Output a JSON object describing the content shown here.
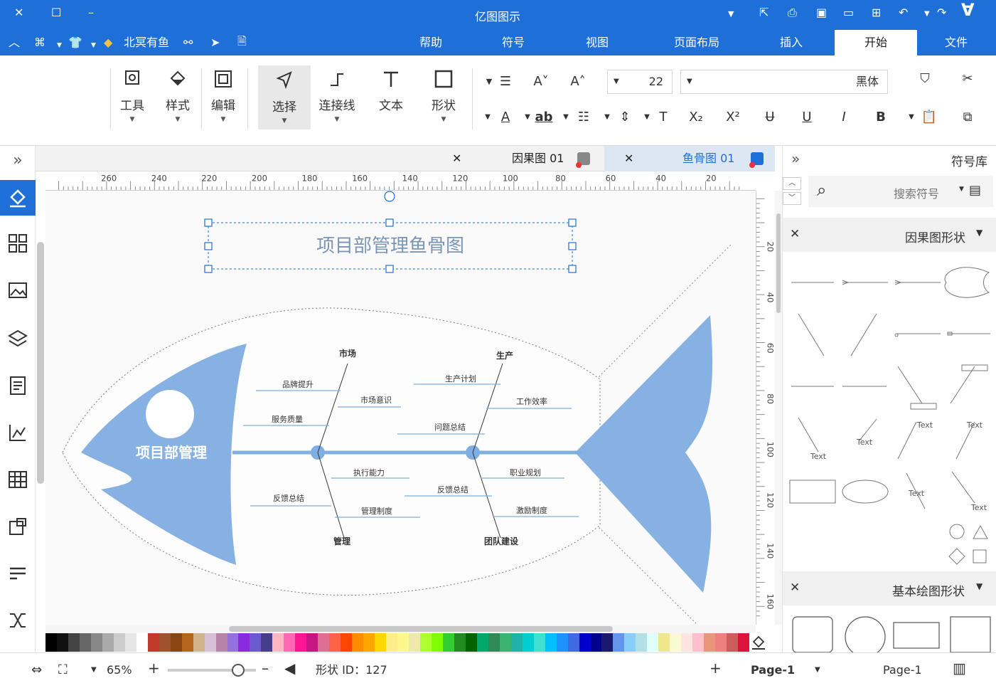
{
  "app": {
    "title": "亿图图示"
  },
  "window": {
    "minimize_icon": "minimize-icon",
    "restore_icon": "restore-icon",
    "close_icon": "close-icon"
  },
  "menu_tabs": [
    "文件",
    "开始",
    "插入",
    "页面布局",
    "视图",
    "符号",
    "帮助"
  ],
  "menu_active": "开始",
  "quickbar": {
    "vip_label": "北冥有鱼"
  },
  "ribbon": {
    "tools": [
      {
        "label": "形状",
        "icon": "rectangle-icon"
      },
      {
        "label": "文本",
        "icon": "text-T-icon"
      },
      {
        "label": "连接线",
        "icon": "connector-icon"
      },
      {
        "label": "选择",
        "icon": "pointer-icon"
      },
      {
        "label": "编辑",
        "icon": "edit-icon"
      },
      {
        "label": "样式",
        "icon": "paint-bucket-icon"
      },
      {
        "label": "工具",
        "icon": "tools-icon"
      }
    ],
    "font_name": "黑体",
    "font_size": "22"
  },
  "doc_tabs": [
    {
      "label": "鱼骨图 01",
      "active": true
    },
    {
      "label": "因果图 01",
      "active": false
    }
  ],
  "ruler": {
    "h_ticks": [
      "20",
      "40",
      "60",
      "80",
      "100",
      "120",
      "140",
      "160",
      "180",
      "200",
      "220",
      "240",
      "260"
    ],
    "v_ticks": [
      "20",
      "40",
      "60",
      "80",
      "100",
      "120",
      "140",
      "160"
    ]
  },
  "diagram": {
    "title": "项目部管理鱼骨图",
    "head_label": "项目部管理",
    "top_categories": [
      {
        "label": "市场",
        "items": [
          "品牌提升",
          "市场意识",
          "服务质量"
        ]
      },
      {
        "label": "生产",
        "items": [
          "生产计划",
          "工作效率",
          "问题总结"
        ]
      }
    ],
    "bottom_categories": [
      {
        "label": "管理",
        "items": [
          "执行能力",
          "反馈总结",
          "管理制度"
        ]
      },
      {
        "label": "团队建设",
        "items": [
          "职业规划",
          "反馈总结",
          "激励制度"
        ]
      }
    ]
  },
  "right_panel": {
    "title": "符号库",
    "search_placeholder": "搜索符号",
    "sections": [
      {
        "label": "因果图形状",
        "shape_text": "Text"
      },
      {
        "label": "基本绘图形状"
      }
    ]
  },
  "status": {
    "page_left": "Page-1",
    "page_current": "Page-1",
    "shape_id": "形状 ID：127",
    "zoom": "65%"
  },
  "colors": {
    "titlebar": "#1f6fd8",
    "fish": "#86b1e2",
    "spine": "#7faee0",
    "accent": "#1f6fd8"
  },
  "palette": [
    "#000000",
    "#111111",
    "#444444",
    "#666666",
    "#888888",
    "#aaaaaa",
    "#cccccc",
    "#e6e6e6",
    "#ffffff",
    "#c0392b",
    "#a0522d",
    "#8b4513",
    "#b5651d",
    "#d2b48c",
    "#d8bfd8",
    "#b784a7",
    "#9370db",
    "#8a2be2",
    "#6a5acd",
    "#483d8b",
    "#ffb6c1",
    "#ff69b4",
    "#ff1493",
    "#c71585",
    "#db7093",
    "#ff6347",
    "#ff4500",
    "#ff8c00",
    "#ffa500",
    "#ffd700",
    "#ffec8b",
    "#fff68f",
    "#eee8aa",
    "#adff2f",
    "#7fff00",
    "#32cd32",
    "#228b22",
    "#006400",
    "#00a86b",
    "#2e8b57",
    "#3cb371",
    "#20b2aa",
    "#00ced1",
    "#40e0d0",
    "#00bfff",
    "#1e90ff",
    "#4169e1",
    "#0000cd",
    "#00008b",
    "#191970",
    "#6495ed",
    "#87cefa",
    "#b0e0e6",
    "#e0ffff",
    "#f0e68c",
    "#fafad2",
    "#ffe4e1",
    "#ffc0cb",
    "#e9967a",
    "#f08080",
    "#cd5c5c",
    "#dc143c"
  ]
}
